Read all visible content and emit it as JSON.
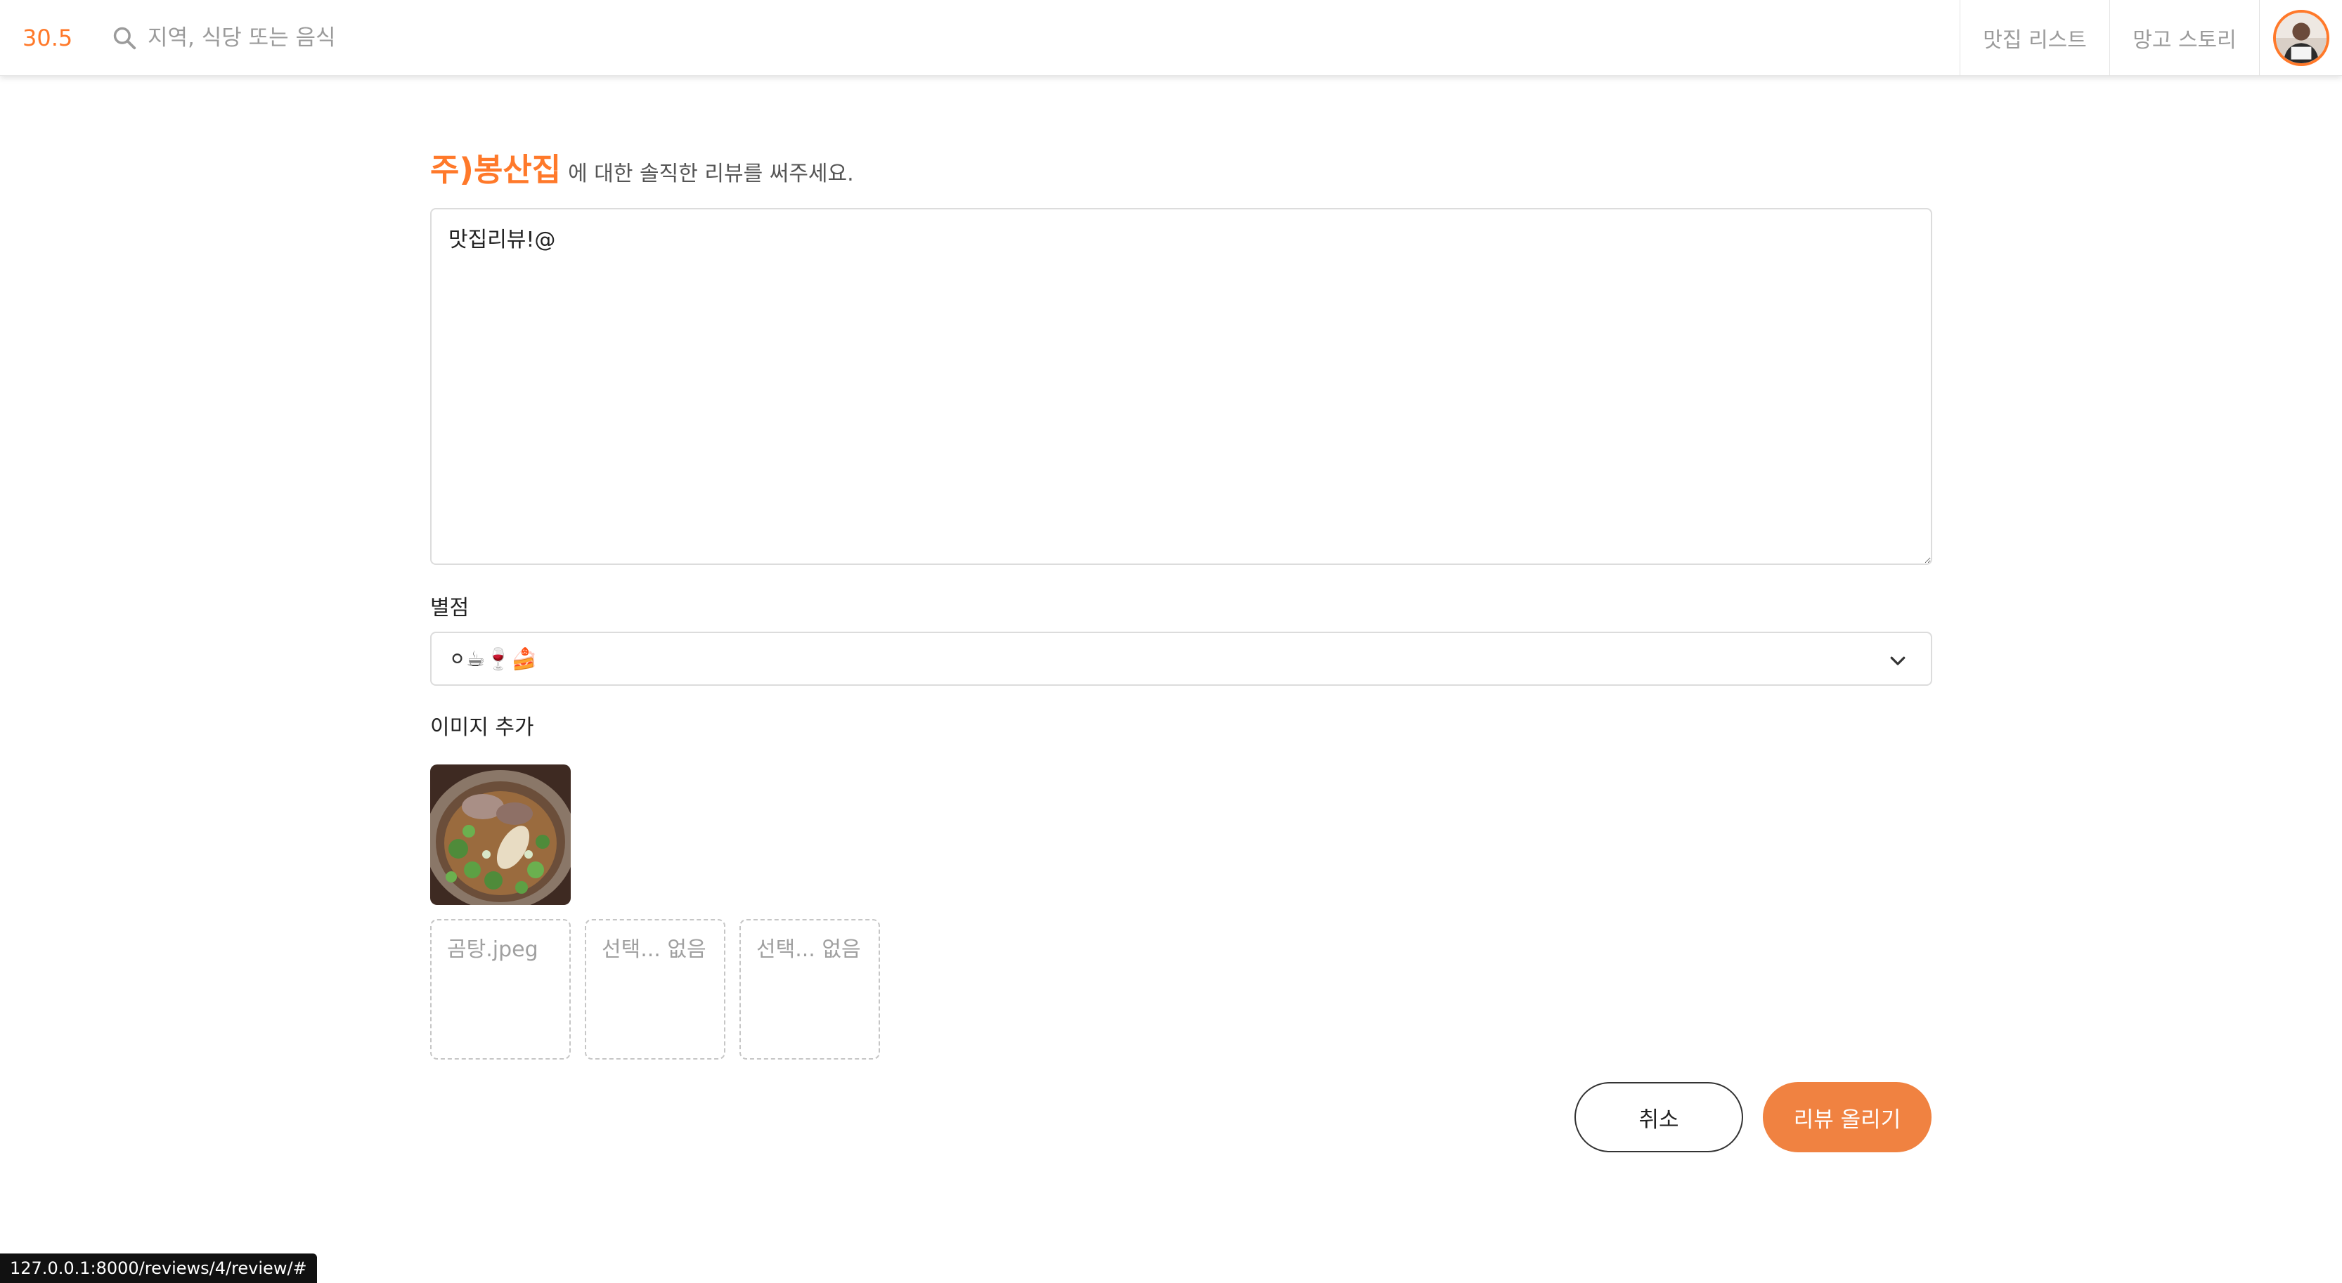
{
  "header": {
    "logo": "30.5",
    "search_placeholder": "지역, 식당 또는 음식",
    "nav": {
      "list": "맛집 리스트",
      "story": "망고 스토리"
    }
  },
  "form": {
    "restaurant_name": "주)봉산집",
    "heading_suffix": "에 대한 솔직한 리뷰를 써주세요.",
    "review_text": "맛집리뷰!@",
    "rating_label": "별점",
    "rating_value": "⚪☕🍷🍰",
    "image_label": "이미지 추가",
    "file_slots": [
      "곰탕.jpeg",
      "선택... 없음",
      "선택... 없음"
    ],
    "cancel_label": "취소",
    "submit_label": "리뷰 올리기"
  },
  "status_url": "127.0.0.1:8000/reviews/4/review/#",
  "colors": {
    "accent": "#ff792a",
    "submit_button": "#f08241"
  }
}
